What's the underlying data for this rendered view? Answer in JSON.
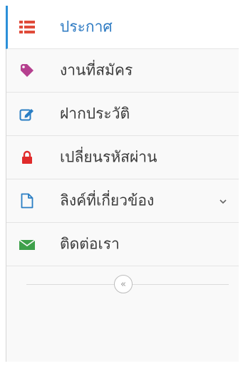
{
  "colors": {
    "accent": "#2b90d9",
    "active_text": "#2b79c2",
    "list_icon": "#e04b3a",
    "tag_icon": "#b5408f",
    "edit_icon": "#2a7ec4",
    "lock_icon": "#e02b2b",
    "file_icon": "#2a7ec4",
    "mail_icon": "#3ea04a"
  },
  "menu": {
    "items": [
      {
        "label": "ประกาศ",
        "icon": "list-icon",
        "active": true
      },
      {
        "label": "งานที่สมัคร",
        "icon": "tag-icon"
      },
      {
        "label": "ฝากประวัติ",
        "icon": "edit-icon"
      },
      {
        "label": "เปลี่ยนรหัสผ่าน",
        "icon": "lock-icon"
      },
      {
        "label": "ลิงค์ที่เกี่ยวข้อง",
        "icon": "file-icon",
        "has_submenu": true
      },
      {
        "label": "ติดต่อเรา",
        "icon": "envelope-icon"
      }
    ]
  },
  "collapse_toggle": {
    "symbol": "«"
  }
}
